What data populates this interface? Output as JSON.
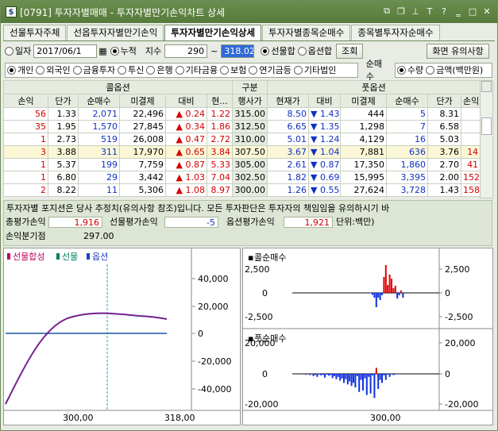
{
  "window": {
    "title": "[0791] 투자자별매매 - 투자자별만기손익차트 상세",
    "app_icon_letter": "$"
  },
  "tabs": [
    "선물투자주체",
    "선옵투자자별만기손익",
    "투자자별만기손익상세",
    "투자자별종목순매수",
    "종목별투자자순매수"
  ],
  "filters": {
    "radio_il": "일자",
    "date": "2017/06/1",
    "radio_nu": "누적",
    "jisu_label": "지수",
    "jisu_from": "290",
    "tilde": "~",
    "jisu_to": "318.02",
    "radio_sunmul": "선물합",
    "radio_option": "옵션합",
    "search_btn": "조회",
    "screen_note_btn": "화면 유의사항"
  },
  "investors": [
    "개인",
    "외국인",
    "금융투자",
    "투신",
    "은행",
    "기타금융",
    "보험",
    "연기금등",
    "기타법인"
  ],
  "metric": {
    "label": "순매수",
    "opt1": "수량",
    "opt2": "금액(백만원)"
  },
  "grid": {
    "call_header": "콜옵션",
    "mid_header": "구분",
    "put_header": "풋옵션",
    "cols": [
      "손익",
      "단가",
      "순매수",
      "미결제",
      "대비",
      "현...",
      "행사가",
      "현재가",
      "대비",
      "미결제",
      "순매수",
      "단가",
      "손익"
    ],
    "rows": [
      [
        "56",
        "1.33",
        "2,071",
        "22,496",
        "▲",
        "0.24",
        "1.22",
        "315.00",
        "8.50",
        "▼",
        "1.43",
        "444",
        "5",
        "8.31",
        ""
      ],
      [
        "35",
        "1.95",
        "1,570",
        "27,845",
        "▲",
        "0.34",
        "1.86",
        "312.50",
        "6.65",
        "▼",
        "1.35",
        "1,298",
        "7",
        "6.58",
        ""
      ],
      [
        "1",
        "2.73",
        "519",
        "26,008",
        "▲",
        "0.47",
        "2.72",
        "310.00",
        "5.01",
        "▼",
        "1.24",
        "4,129",
        "16",
        "5.03",
        ""
      ],
      [
        "3",
        "3.88",
        "311",
        "17,970",
        "▲",
        "0.65",
        "3.84",
        "307.50",
        "3.67",
        "▼",
        "1.04",
        "7,881",
        "636",
        "3.76",
        "14"
      ],
      [
        "1",
        "5.37",
        "199",
        "7,759",
        "▲",
        "0.87",
        "5.33",
        "305.00",
        "2.61",
        "▼",
        "0.87",
        "17,350",
        "1,860",
        "2.70",
        "41"
      ],
      [
        "1",
        "6.80",
        "29",
        "3,442",
        "▲",
        "1.03",
        "7.04",
        "302.50",
        "1.82",
        "▼",
        "0.69",
        "15,995",
        "3,395",
        "2.00",
        "152"
      ],
      [
        "2",
        "8.22",
        "11",
        "5,306",
        "▲",
        "1.08",
        "8.97",
        "300.00",
        "1.26",
        "▼",
        "0.55",
        "27,624",
        "3,728",
        "1.43",
        "158"
      ]
    ]
  },
  "info": {
    "notice": "투자자별 포지션은 당사 추정치(유의사항 참조)입니다. 모든 투자판단은 투자자의 책임임을 유의하시기 바",
    "total_label": "총평가손익",
    "total_val": "1,916",
    "fut_label": "선물평가손익",
    "fut_val": "-5",
    "opt_label": "옵션평가손익",
    "opt_val": "1,921",
    "unit": "단위:백만)",
    "bep_label": "손익분기점",
    "bep_val": "297.00"
  },
  "chart_data": [
    {
      "type": "line",
      "legend": [
        "선물합성",
        "선물",
        "옵션"
      ],
      "colors": [
        "#c00060",
        "#008060",
        "#2040c0"
      ],
      "yticks": [
        "40,000",
        "20,000",
        "0",
        "-20,000",
        "-40,000"
      ],
      "xticks": [
        "300,00",
        "318,00"
      ]
    },
    {
      "type": "bar",
      "title": "콜순매수",
      "yticks": [
        "2,500",
        "0",
        "-2,500"
      ],
      "values": [
        0,
        0,
        0,
        0,
        0,
        0,
        0,
        0,
        0,
        0,
        0,
        0,
        0,
        0,
        0,
        0,
        0,
        0,
        0,
        0,
        0,
        0,
        0,
        0,
        0,
        0,
        0,
        0,
        0,
        0,
        0,
        0,
        0,
        0,
        0,
        0,
        0,
        0,
        0,
        -50,
        -250,
        -600,
        -1800,
        -600,
        -900,
        -300,
        2000,
        3500,
        1000,
        2300,
        1800,
        600,
        900,
        -700,
        -300,
        300,
        -600,
        0,
        0,
        0,
        0,
        0,
        0,
        0,
        0,
        0,
        0,
        0,
        0,
        0,
        0,
        0,
        0,
        0,
        0,
        0,
        0,
        0,
        0,
        0
      ]
    },
    {
      "type": "bar",
      "title": "풋순매수",
      "yticks": [
        "20,000",
        "0",
        "-20,000"
      ],
      "xticks": [
        "300,00"
      ],
      "values": [
        0,
        0,
        0,
        0,
        300,
        -600,
        -200,
        -800,
        0,
        -1500,
        -700,
        -2000,
        -400,
        -1000,
        -700,
        -2500,
        -500,
        -1200,
        -800,
        -2800,
        -1500,
        -3500,
        -2000,
        -4500,
        -3000,
        -6000,
        -3500,
        -7000,
        -5000,
        -8000,
        -6000,
        -9000,
        -1500,
        -12000,
        -4000,
        -11000,
        -3000,
        -14000,
        -2000,
        -13000,
        -1000,
        -16000,
        4000,
        -10000,
        -4000,
        -6000,
        -1000,
        -4000,
        -500,
        -2000,
        -300,
        -800,
        -400,
        -200,
        -100,
        0,
        0,
        0,
        0,
        0,
        0,
        0,
        0,
        0,
        0,
        0,
        0,
        0,
        0,
        0,
        0,
        0,
        0,
        0
      ]
    }
  ]
}
